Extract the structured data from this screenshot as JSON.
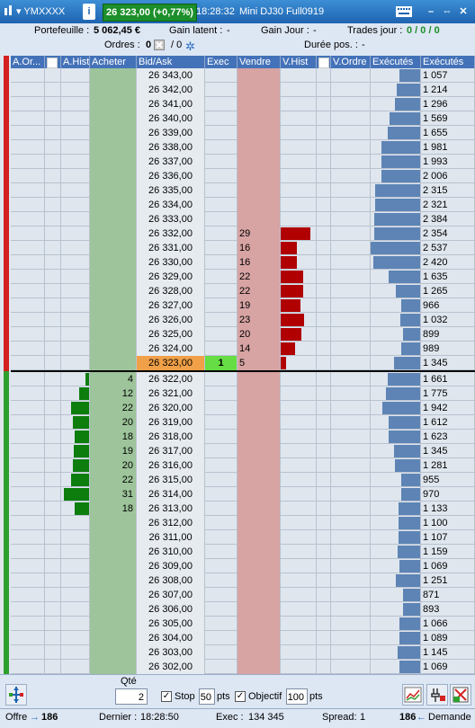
{
  "titlebar": {
    "instrument": "YMXXXX",
    "price": "26 323,00 (+0,77%)",
    "time": "18:28:32",
    "contract": "Mini DJ30 Full0919"
  },
  "stats": {
    "portefeuille_label": "Portefeuille :",
    "portefeuille_value": "5 062,45 €",
    "gain_latent_label": "Gain latent :",
    "gain_latent_value": "-",
    "gain_jour_label": "Gain Jour :",
    "gain_jour_value": "-",
    "trades_jour_label": "Trades jour :",
    "trades_jour_value": "0 / 0 / 0",
    "ordres_label": "Ordres :",
    "ordres_value": "0",
    "ordres_sep": "/ 0",
    "duree_label": "Durée pos. :",
    "duree_value": "-"
  },
  "columns": [
    "A.Or...",
    "",
    "A.Hist",
    "Acheter",
    "Bid/Ask",
    "Exec",
    "Vendre",
    "V.Hist",
    "",
    "V.Ordre",
    "Exécutés",
    "Exécutés"
  ],
  "ladder": [
    {
      "price": "26 343,00",
      "buy": "",
      "sell": "",
      "vhist": 0,
      "ahist": 0,
      "exec": "",
      "executed": 1057
    },
    {
      "price": "26 342,00",
      "buy": "",
      "sell": "",
      "vhist": 0,
      "ahist": 0,
      "exec": "",
      "executed": 1214
    },
    {
      "price": "26 341,00",
      "buy": "",
      "sell": "",
      "vhist": 0,
      "ahist": 0,
      "exec": "",
      "executed": 1296
    },
    {
      "price": "26 340,00",
      "buy": "",
      "sell": "",
      "vhist": 0,
      "ahist": 0,
      "exec": "",
      "executed": 1569
    },
    {
      "price": "26 339,00",
      "buy": "",
      "sell": "",
      "vhist": 0,
      "ahist": 0,
      "exec": "",
      "executed": 1655
    },
    {
      "price": "26 338,00",
      "buy": "",
      "sell": "",
      "vhist": 0,
      "ahist": 0,
      "exec": "",
      "executed": 1981
    },
    {
      "price": "26 337,00",
      "buy": "",
      "sell": "",
      "vhist": 0,
      "ahist": 0,
      "exec": "",
      "executed": 1993
    },
    {
      "price": "26 336,00",
      "buy": "",
      "sell": "",
      "vhist": 0,
      "ahist": 0,
      "exec": "",
      "executed": 2006
    },
    {
      "price": "26 335,00",
      "buy": "",
      "sell": "",
      "vhist": 0,
      "ahist": 0,
      "exec": "",
      "executed": 2315
    },
    {
      "price": "26 334,00",
      "buy": "",
      "sell": "",
      "vhist": 0,
      "ahist": 0,
      "exec": "",
      "executed": 2321
    },
    {
      "price": "26 333,00",
      "buy": "",
      "sell": "",
      "vhist": 0,
      "ahist": 0,
      "exec": "",
      "executed": 2384
    },
    {
      "price": "26 332,00",
      "buy": "",
      "sell": "29",
      "vhist": 29,
      "ahist": 0,
      "exec": "",
      "executed": 2354
    },
    {
      "price": "26 331,00",
      "buy": "",
      "sell": "16",
      "vhist": 16,
      "ahist": 0,
      "exec": "",
      "executed": 2537
    },
    {
      "price": "26 330,00",
      "buy": "",
      "sell": "16",
      "vhist": 16,
      "ahist": 0,
      "exec": "",
      "executed": 2420
    },
    {
      "price": "26 329,00",
      "buy": "",
      "sell": "22",
      "vhist": 22,
      "ahist": 0,
      "exec": "",
      "executed": 1635
    },
    {
      "price": "26 328,00",
      "buy": "",
      "sell": "22",
      "vhist": 22,
      "ahist": 0,
      "exec": "",
      "executed": 1265
    },
    {
      "price": "26 327,00",
      "buy": "",
      "sell": "19",
      "vhist": 19,
      "ahist": 0,
      "exec": "",
      "executed": 966
    },
    {
      "price": "26 326,00",
      "buy": "",
      "sell": "23",
      "vhist": 23,
      "ahist": 0,
      "exec": "",
      "executed": 1032
    },
    {
      "price": "26 325,00",
      "buy": "",
      "sell": "20",
      "vhist": 20,
      "ahist": 0,
      "exec": "",
      "executed": 899
    },
    {
      "price": "26 324,00",
      "buy": "",
      "sell": "14",
      "vhist": 14,
      "ahist": 0,
      "exec": "",
      "executed": 989
    },
    {
      "price": "26 323,00",
      "buy": "",
      "sell": "5",
      "vhist": 5,
      "ahist": 0,
      "exec": "1",
      "executed": 1345,
      "last": true
    },
    {
      "price": "26 322,00",
      "buy": "4",
      "sell": "",
      "vhist": 0,
      "ahist": 4,
      "exec": "",
      "executed": 1661
    },
    {
      "price": "26 321,00",
      "buy": "12",
      "sell": "",
      "vhist": 0,
      "ahist": 12,
      "exec": "",
      "executed": 1775
    },
    {
      "price": "26 320,00",
      "buy": "22",
      "sell": "",
      "vhist": 0,
      "ahist": 22,
      "exec": "",
      "executed": 1942
    },
    {
      "price": "26 319,00",
      "buy": "20",
      "sell": "",
      "vhist": 0,
      "ahist": 20,
      "exec": "",
      "executed": 1612
    },
    {
      "price": "26 318,00",
      "buy": "18",
      "sell": "",
      "vhist": 0,
      "ahist": 18,
      "exec": "",
      "executed": 1623
    },
    {
      "price": "26 317,00",
      "buy": "19",
      "sell": "",
      "vhist": 0,
      "ahist": 19,
      "exec": "",
      "executed": 1345
    },
    {
      "price": "26 316,00",
      "buy": "20",
      "sell": "",
      "vhist": 0,
      "ahist": 20,
      "exec": "",
      "executed": 1281
    },
    {
      "price": "26 315,00",
      "buy": "22",
      "sell": "",
      "vhist": 0,
      "ahist": 22,
      "exec": "",
      "executed": 955
    },
    {
      "price": "26 314,00",
      "buy": "31",
      "sell": "",
      "vhist": 0,
      "ahist": 31,
      "exec": "",
      "executed": 970
    },
    {
      "price": "26 313,00",
      "buy": "18",
      "sell": "",
      "vhist": 0,
      "ahist": 18,
      "exec": "",
      "executed": 1133
    },
    {
      "price": "26 312,00",
      "buy": "",
      "sell": "",
      "vhist": 0,
      "ahist": 0,
      "exec": "",
      "executed": 1100
    },
    {
      "price": "26 311,00",
      "buy": "",
      "sell": "",
      "vhist": 0,
      "ahist": 0,
      "exec": "",
      "executed": 1107
    },
    {
      "price": "26 310,00",
      "buy": "",
      "sell": "",
      "vhist": 0,
      "ahist": 0,
      "exec": "",
      "executed": 1159
    },
    {
      "price": "26 309,00",
      "buy": "",
      "sell": "",
      "vhist": 0,
      "ahist": 0,
      "exec": "",
      "executed": 1069
    },
    {
      "price": "26 308,00",
      "buy": "",
      "sell": "",
      "vhist": 0,
      "ahist": 0,
      "exec": "",
      "executed": 1251
    },
    {
      "price": "26 307,00",
      "buy": "",
      "sell": "",
      "vhist": 0,
      "ahist": 0,
      "exec": "",
      "executed": 871
    },
    {
      "price": "26 306,00",
      "buy": "",
      "sell": "",
      "vhist": 0,
      "ahist": 0,
      "exec": "",
      "executed": 893
    },
    {
      "price": "26 305,00",
      "buy": "",
      "sell": "",
      "vhist": 0,
      "ahist": 0,
      "exec": "",
      "executed": 1066
    },
    {
      "price": "26 304,00",
      "buy": "",
      "sell": "",
      "vhist": 0,
      "ahist": 0,
      "exec": "",
      "executed": 1089
    },
    {
      "price": "26 303,00",
      "buy": "",
      "sell": "",
      "vhist": 0,
      "ahist": 0,
      "exec": "",
      "executed": 1145
    },
    {
      "price": "26 302,00",
      "buy": "",
      "sell": "",
      "vhist": 0,
      "ahist": 0,
      "exec": "",
      "executed": 1069
    }
  ],
  "controls": {
    "qty_label": "Qté",
    "qty_value": "2",
    "stop_label": "Stop",
    "stop_value": "50",
    "stop_unit": "pts",
    "objectif_label": "Objectif",
    "objectif_value": "100",
    "objectif_unit": "pts"
  },
  "status": {
    "offre_label": "Offre",
    "offre_value": "186",
    "dernier_label": "Dernier :",
    "dernier_value": "18:28:50",
    "exec_label": "Exec :",
    "exec_value": "134 345",
    "spread_label": "Spread:",
    "spread_value": "1",
    "demande_value": "186",
    "demande_label": "Demande"
  },
  "colors": {
    "buy_bg": "#9dc49a",
    "sell_bg": "#d7a3a3",
    "vhist_bar": "#b00000",
    "ahist_bar": "#0d7d0d",
    "executed_bar": "#5d84b5",
    "last_price_bg": "#f0a048",
    "exec_bg": "#66dd44",
    "header_bg": "#4472b8"
  }
}
